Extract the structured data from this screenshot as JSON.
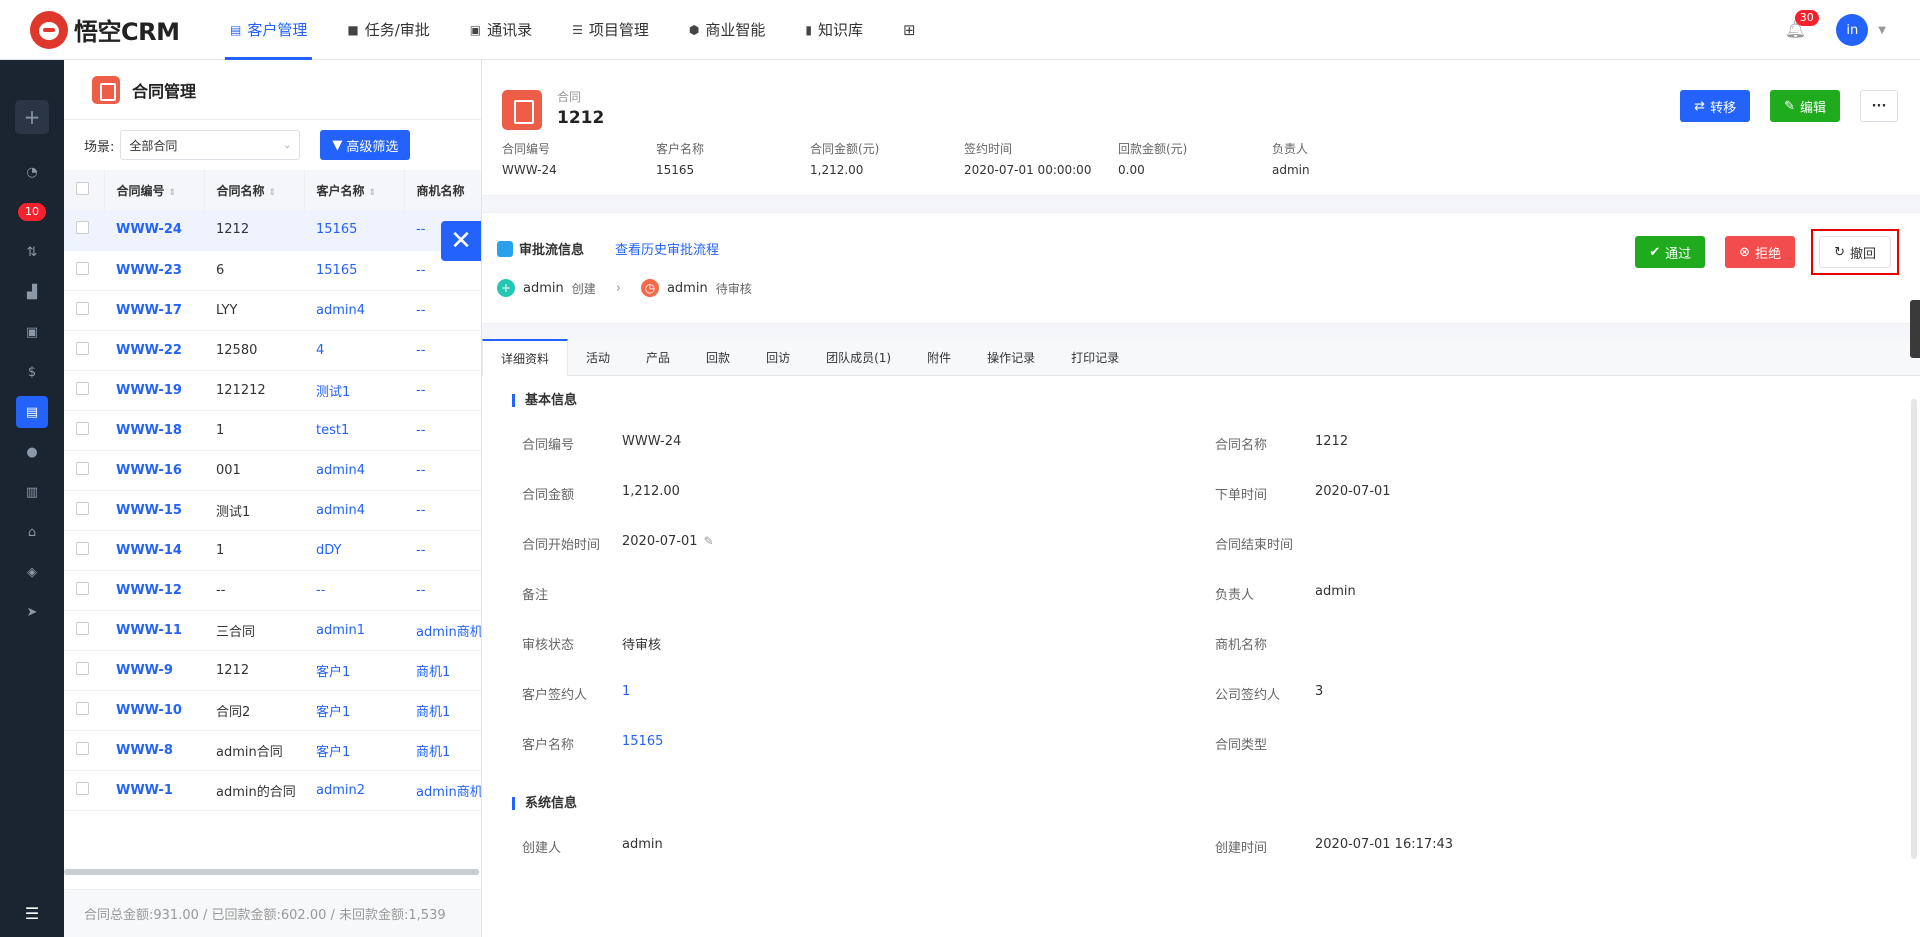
{
  "app": {
    "logo_text": "悟空CRM"
  },
  "nav": [
    {
      "label": "客户管理",
      "icon": "customer-doc-icon",
      "active": true
    },
    {
      "label": "任务/审批",
      "icon": "briefcase-icon"
    },
    {
      "label": "通讯录",
      "icon": "phonebook-icon"
    },
    {
      "label": "项目管理",
      "icon": "list-icon"
    },
    {
      "label": "商业智能",
      "icon": "shield-icon"
    },
    {
      "label": "知识库",
      "icon": "book-icon"
    }
  ],
  "top": {
    "notification_count": "30",
    "user_initials": "in"
  },
  "sidebar": {
    "badge": "10"
  },
  "list": {
    "title": "合同管理",
    "scene_label": "场景:",
    "scene_value": "全部合同",
    "advanced_filter": "高级筛选",
    "columns": [
      "合同编号",
      "合同名称",
      "客户名称",
      "商机名称"
    ],
    "rows": [
      {
        "no": "WWW-24",
        "name": "1212",
        "customer": "15165",
        "opp": "--"
      },
      {
        "no": "WWW-23",
        "name": "6",
        "customer": "15165",
        "opp": "--"
      },
      {
        "no": "WWW-17",
        "name": "LYY",
        "customer": "admin4",
        "opp": "--"
      },
      {
        "no": "WWW-22",
        "name": "12580",
        "customer": "4",
        "opp": "--"
      },
      {
        "no": "WWW-19",
        "name": "121212",
        "customer": "测试1",
        "opp": "--"
      },
      {
        "no": "WWW-18",
        "name": "1",
        "customer": "test1",
        "opp": "--"
      },
      {
        "no": "WWW-16",
        "name": "001",
        "customer": "admin4",
        "opp": "--"
      },
      {
        "no": "WWW-15",
        "name": "测试1",
        "customer": "admin4",
        "opp": "--"
      },
      {
        "no": "WWW-14",
        "name": "1",
        "customer": "dDY",
        "opp": "--"
      },
      {
        "no": "WWW-12",
        "name": "--",
        "customer": "--",
        "opp": "--"
      },
      {
        "no": "WWW-11",
        "name": "三合同",
        "customer": "admin1",
        "opp": "admin商机"
      },
      {
        "no": "WWW-9",
        "name": "1212",
        "customer": "客户1",
        "opp": "商机1"
      },
      {
        "no": "WWW-10",
        "name": "合同2",
        "customer": "客户1",
        "opp": "商机1"
      },
      {
        "no": "WWW-8",
        "name": "admin合同",
        "customer": "客户1",
        "opp": "商机1"
      },
      {
        "no": "WWW-1",
        "name": "admin的合同",
        "customer": "admin2",
        "opp": "admin商机"
      }
    ],
    "footer": "合同总金额:931.00 / 已回款金额:602.00 / 未回款金额:1,539"
  },
  "detail": {
    "type_label": "合同",
    "name": "1212",
    "actions": {
      "transfer": "转移",
      "edit": "编辑",
      "more": "···"
    },
    "summary": [
      {
        "key": "合同编号",
        "value": "WWW-24"
      },
      {
        "key": "客户名称",
        "value": "15165"
      },
      {
        "key": "合同金额(元)",
        "value": "1,212.00"
      },
      {
        "key": "签约时间",
        "value": "2020-07-01 00:00:00"
      },
      {
        "key": "回款金额(元)",
        "value": "0.00"
      },
      {
        "key": "负责人",
        "value": "admin"
      }
    ],
    "approval": {
      "title": "审批流信息",
      "history_link": "查看历史审批流程",
      "step1_user": "admin",
      "step1_status": "创建",
      "step2_user": "admin",
      "step2_status": "待审核",
      "approve": "通过",
      "reject": "拒绝",
      "withdraw": "撤回"
    },
    "tabs": [
      "详细资料",
      "活动",
      "产品",
      "回款",
      "回访",
      "团队成员(1)",
      "附件",
      "操作记录",
      "打印记录"
    ],
    "basic_title": "基本信息",
    "basic": [
      {
        "lk": "合同编号",
        "lv": "WWW-24",
        "rk": "合同名称",
        "rv": "1212"
      },
      {
        "lk": "合同金额",
        "lv": "1,212.00",
        "rk": "下单时间",
        "rv": "2020-07-01"
      },
      {
        "lk": "合同开始时间",
        "lv": "2020-07-01",
        "rk": "合同结束时间",
        "rv": ""
      },
      {
        "lk": "备注",
        "lv": "",
        "rk": "负责人",
        "rv": "admin"
      },
      {
        "lk": "审核状态",
        "lv": "待审核",
        "rk": "商机名称",
        "rv": ""
      },
      {
        "lk": "客户签约人",
        "lv": "1",
        "rk": "公司签约人",
        "rv": "3"
      },
      {
        "lk": "客户名称",
        "lv": "15165",
        "rk": "合同类型",
        "rv": ""
      }
    ],
    "system_title": "系统信息",
    "system": [
      {
        "lk": "创建人",
        "lv": "admin",
        "rk": "创建时间",
        "rv": "2020-07-01 16:17:43"
      }
    ]
  }
}
